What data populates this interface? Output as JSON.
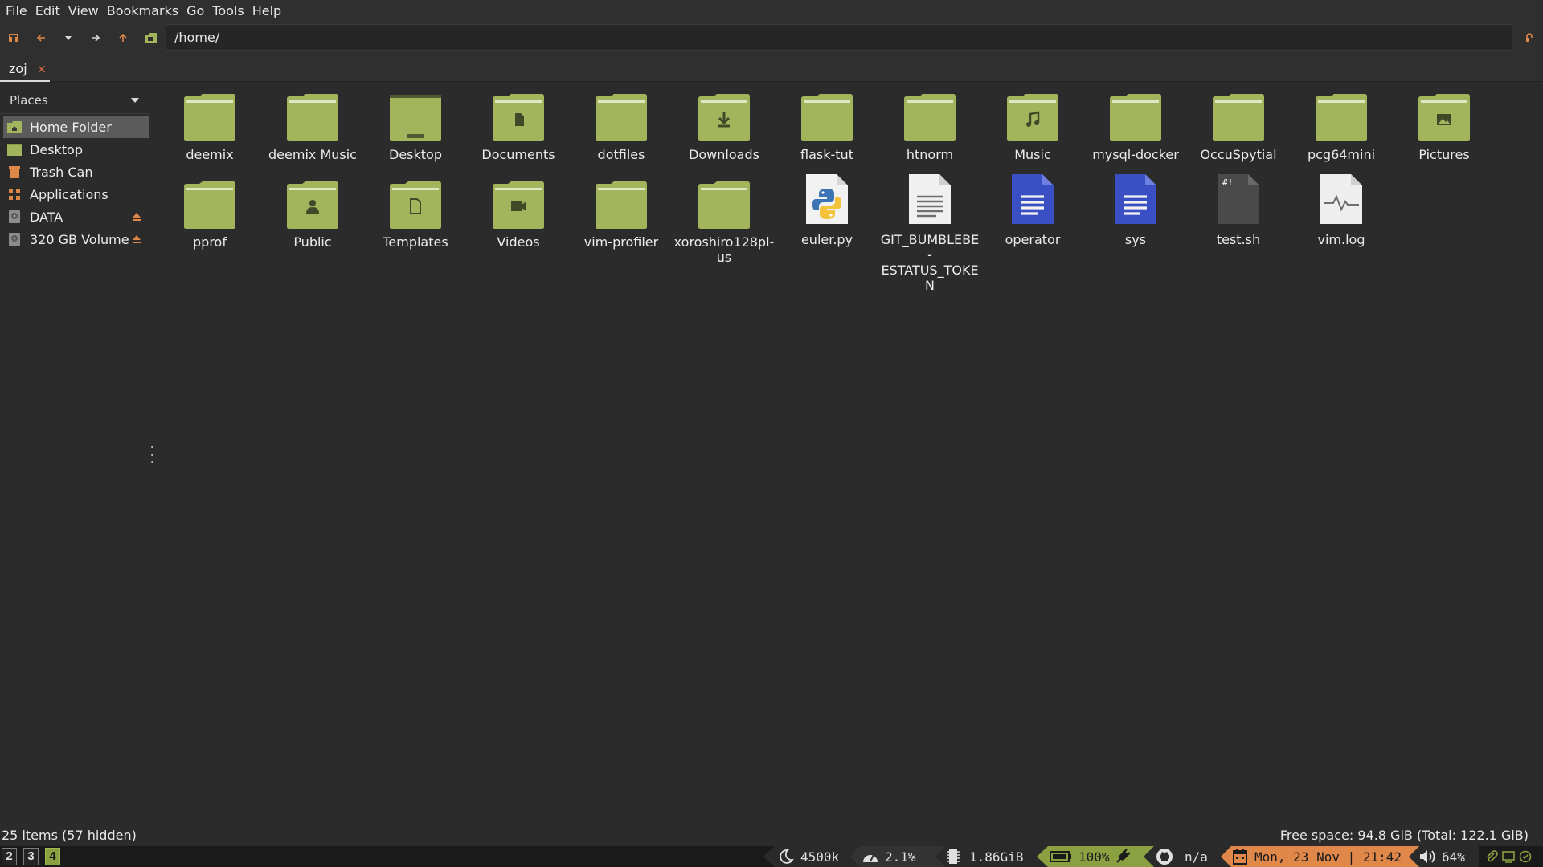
{
  "menubar": {
    "items": [
      "File",
      "Edit",
      "View",
      "Bookmarks",
      "Go",
      "Tools",
      "Help"
    ]
  },
  "toolbar": {
    "path": "/home/",
    "icons": [
      "home-icon",
      "back-arrow-icon",
      "history-dropdown-icon",
      "forward-arrow-icon",
      "up-arrow-icon",
      "folder-view-icon",
      "lock-icon"
    ]
  },
  "tabs": [
    {
      "label": "zoj",
      "close": "×"
    }
  ],
  "sidebar": {
    "header": "Places",
    "items": [
      {
        "label": "Home Folder",
        "icon": "home-folder-icon",
        "selected": true
      },
      {
        "label": "Desktop",
        "icon": "desktop-icon"
      },
      {
        "label": "Trash Can",
        "icon": "trash-icon"
      },
      {
        "label": "Applications",
        "icon": "applications-icon"
      },
      {
        "label": "DATA",
        "icon": "drive-icon",
        "eject": true
      },
      {
        "label": "320 GB Volume",
        "icon": "drive-icon",
        "eject": true
      }
    ]
  },
  "files": [
    {
      "name": "deemix",
      "type": "folder"
    },
    {
      "name": "deemix Music",
      "type": "folder"
    },
    {
      "name": "Desktop",
      "type": "folder-desktop"
    },
    {
      "name": "Documents",
      "type": "folder-documents"
    },
    {
      "name": "dotfiles",
      "type": "folder"
    },
    {
      "name": "Downloads",
      "type": "folder-downloads"
    },
    {
      "name": "flask-tut",
      "type": "folder"
    },
    {
      "name": "htnorm",
      "type": "folder"
    },
    {
      "name": "Music",
      "type": "folder-music"
    },
    {
      "name": "mysql-docker",
      "type": "folder"
    },
    {
      "name": "OccuSpytial",
      "type": "folder"
    },
    {
      "name": "pcg64mini",
      "type": "folder"
    },
    {
      "name": "Pictures",
      "type": "folder-pictures"
    },
    {
      "name": "pprof",
      "type": "folder"
    },
    {
      "name": "Public",
      "type": "folder-public"
    },
    {
      "name": "Templates",
      "type": "folder-templates"
    },
    {
      "name": "Videos",
      "type": "folder-videos"
    },
    {
      "name": "vim-profiler",
      "type": "folder"
    },
    {
      "name": "xoroshiro128pl-us",
      "type": "folder"
    },
    {
      "name": "euler.py",
      "type": "python"
    },
    {
      "name": "GIT_BUMBLEBE-ESTATUS_TOKEN",
      "type": "text"
    },
    {
      "name": "operator",
      "type": "doc"
    },
    {
      "name": "sys",
      "type": "doc"
    },
    {
      "name": "test.sh",
      "type": "script"
    },
    {
      "name": "vim.log",
      "type": "log"
    }
  ],
  "statusbar": {
    "items": "25 items (57 hidden)",
    "free_space": "Free space: 94.8 GiB (Total: 122.1 GiB)"
  },
  "i3bar": {
    "workspaces": [
      {
        "num": "2",
        "focused": false
      },
      {
        "num": "3",
        "focused": false
      },
      {
        "num": "4",
        "focused": true
      }
    ],
    "blocks": {
      "redshift": "4500k",
      "cpu": "2.1%",
      "memory": "1.86GiB",
      "battery": "100%",
      "github": "n/a",
      "datetime": "Mon, 23 Nov | 21:42",
      "volume": "64%"
    }
  },
  "colors": {
    "folder": "#a3b55c",
    "accent_orange": "#e0874a",
    "workspace_focused": "#8aa041",
    "doc_blue": "#3b4fc4"
  }
}
